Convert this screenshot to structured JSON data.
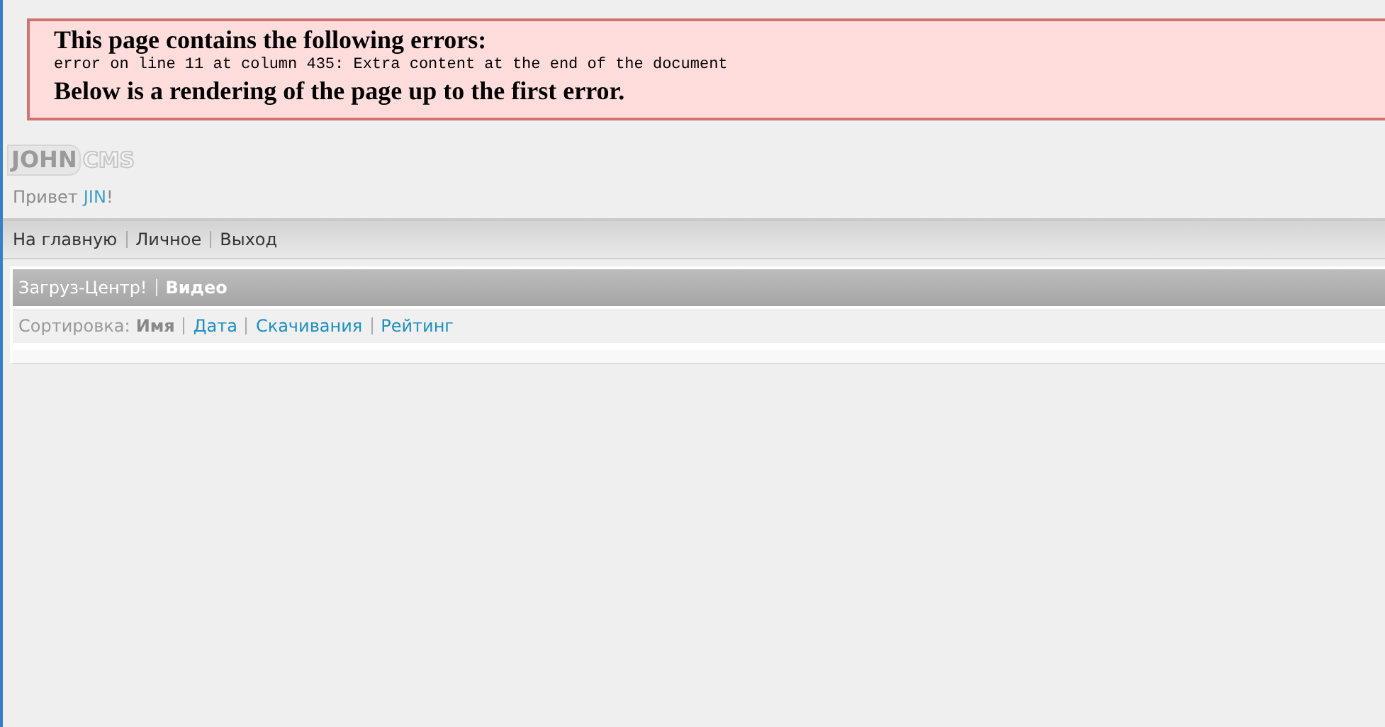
{
  "error_box": {
    "title": "This page contains the following errors:",
    "message": "error on line 11 at column 435: Extra content at the end of the document",
    "footer": "Below is a rendering of the page up to the first error."
  },
  "logo": {
    "part_1": "JOHN",
    "part_2": "CMS"
  },
  "greeting": {
    "text": "Привет",
    "user": "JIN",
    "punct": "!"
  },
  "nav": [
    "На главную",
    "Личное",
    "Выход"
  ],
  "breadcrumb": [
    {
      "label": "Загруз-Центр!",
      "current": false
    },
    {
      "label": "Видео",
      "current": true
    }
  ],
  "sort": {
    "label": "Сортировка:",
    "options": [
      {
        "label": "Имя",
        "selected": true
      },
      {
        "label": "Дата",
        "selected": false
      },
      {
        "label": "Скачивания",
        "selected": false
      },
      {
        "label": "Рейтинг",
        "selected": false
      }
    ]
  }
}
